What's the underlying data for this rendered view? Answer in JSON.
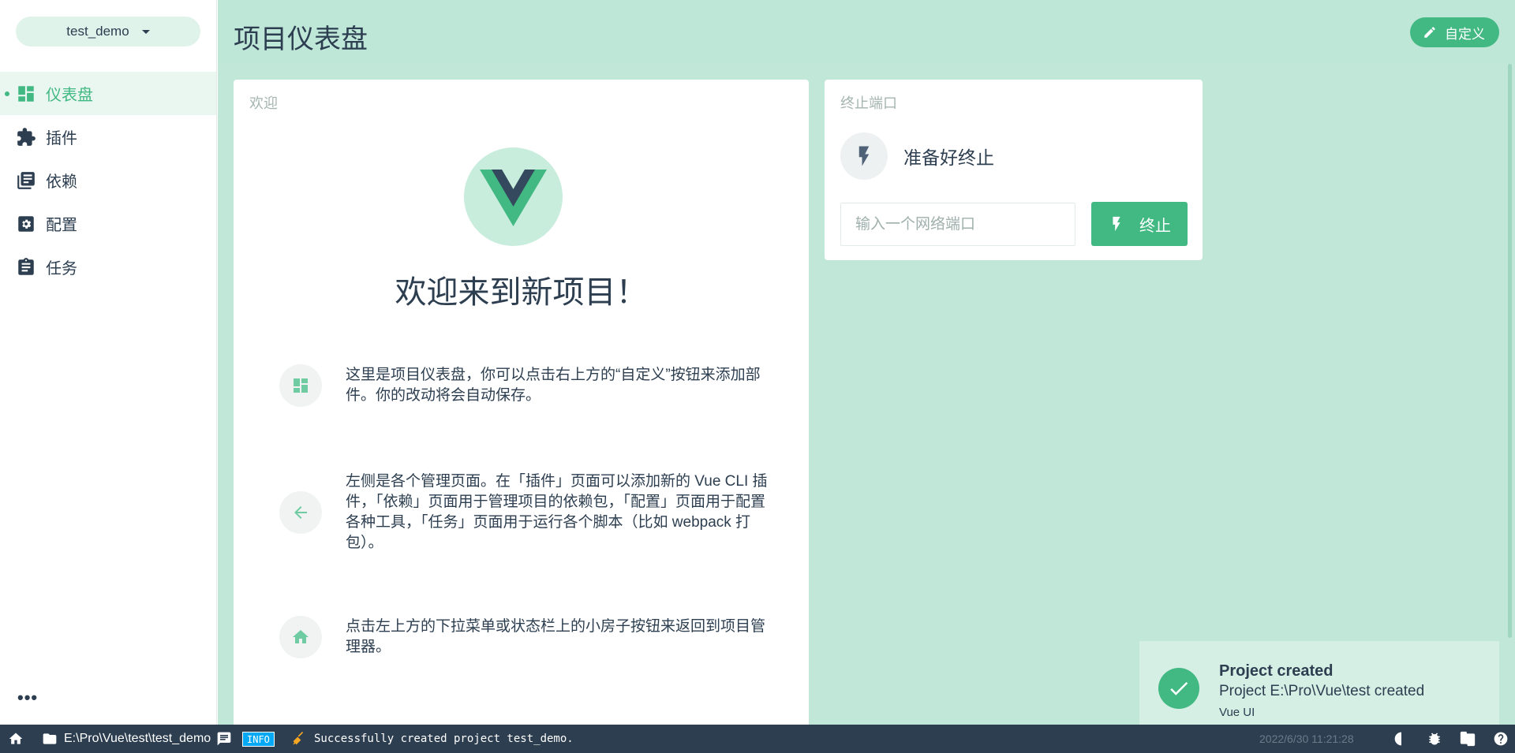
{
  "sidebar": {
    "project_name": "test_demo",
    "items": [
      {
        "label": "仪表盘"
      },
      {
        "label": "插件"
      },
      {
        "label": "依赖"
      },
      {
        "label": "配置"
      },
      {
        "label": "任务"
      }
    ],
    "more_label": "•••"
  },
  "header": {
    "title": "项目仪表盘",
    "customize_label": "自定义"
  },
  "welcome": {
    "card_title": "欢迎",
    "heading": "欢迎来到新项目！",
    "tips": [
      "这里是项目仪表盘，你可以点击右上方的“自定义”按钮来添加部件。你的改动将会自动保存。",
      "左侧是各个管理页面。在「插件」页面可以添加新的 Vue CLI 插件，「依赖」页面用于管理项目的依赖包，「配置」页面用于配置各种工具，「任务」页面用于运行各个脚本（比如 webpack 打包）。",
      "点击左上方的下拉菜单或状态栏上的小房子按钮来返回到项目管理器。"
    ]
  },
  "kill_port": {
    "card_title": "终止端口",
    "status": "准备好终止",
    "input_placeholder": "输入一个网络端口",
    "button_label": "终止"
  },
  "toast": {
    "title": "Project created",
    "message": "Project E:\\Pro\\Vue\\test created",
    "source": "Vue UI"
  },
  "statusbar": {
    "path": "E:\\Pro\\Vue\\test\\test_demo",
    "log_level": "INFO",
    "log_message": "Successfully created project test_demo.",
    "timestamp": "2022/6/30 11:21:28"
  },
  "colors": {
    "accent": "#42b983",
    "dark": "#2c3e50",
    "background": "#c0e7d7"
  }
}
